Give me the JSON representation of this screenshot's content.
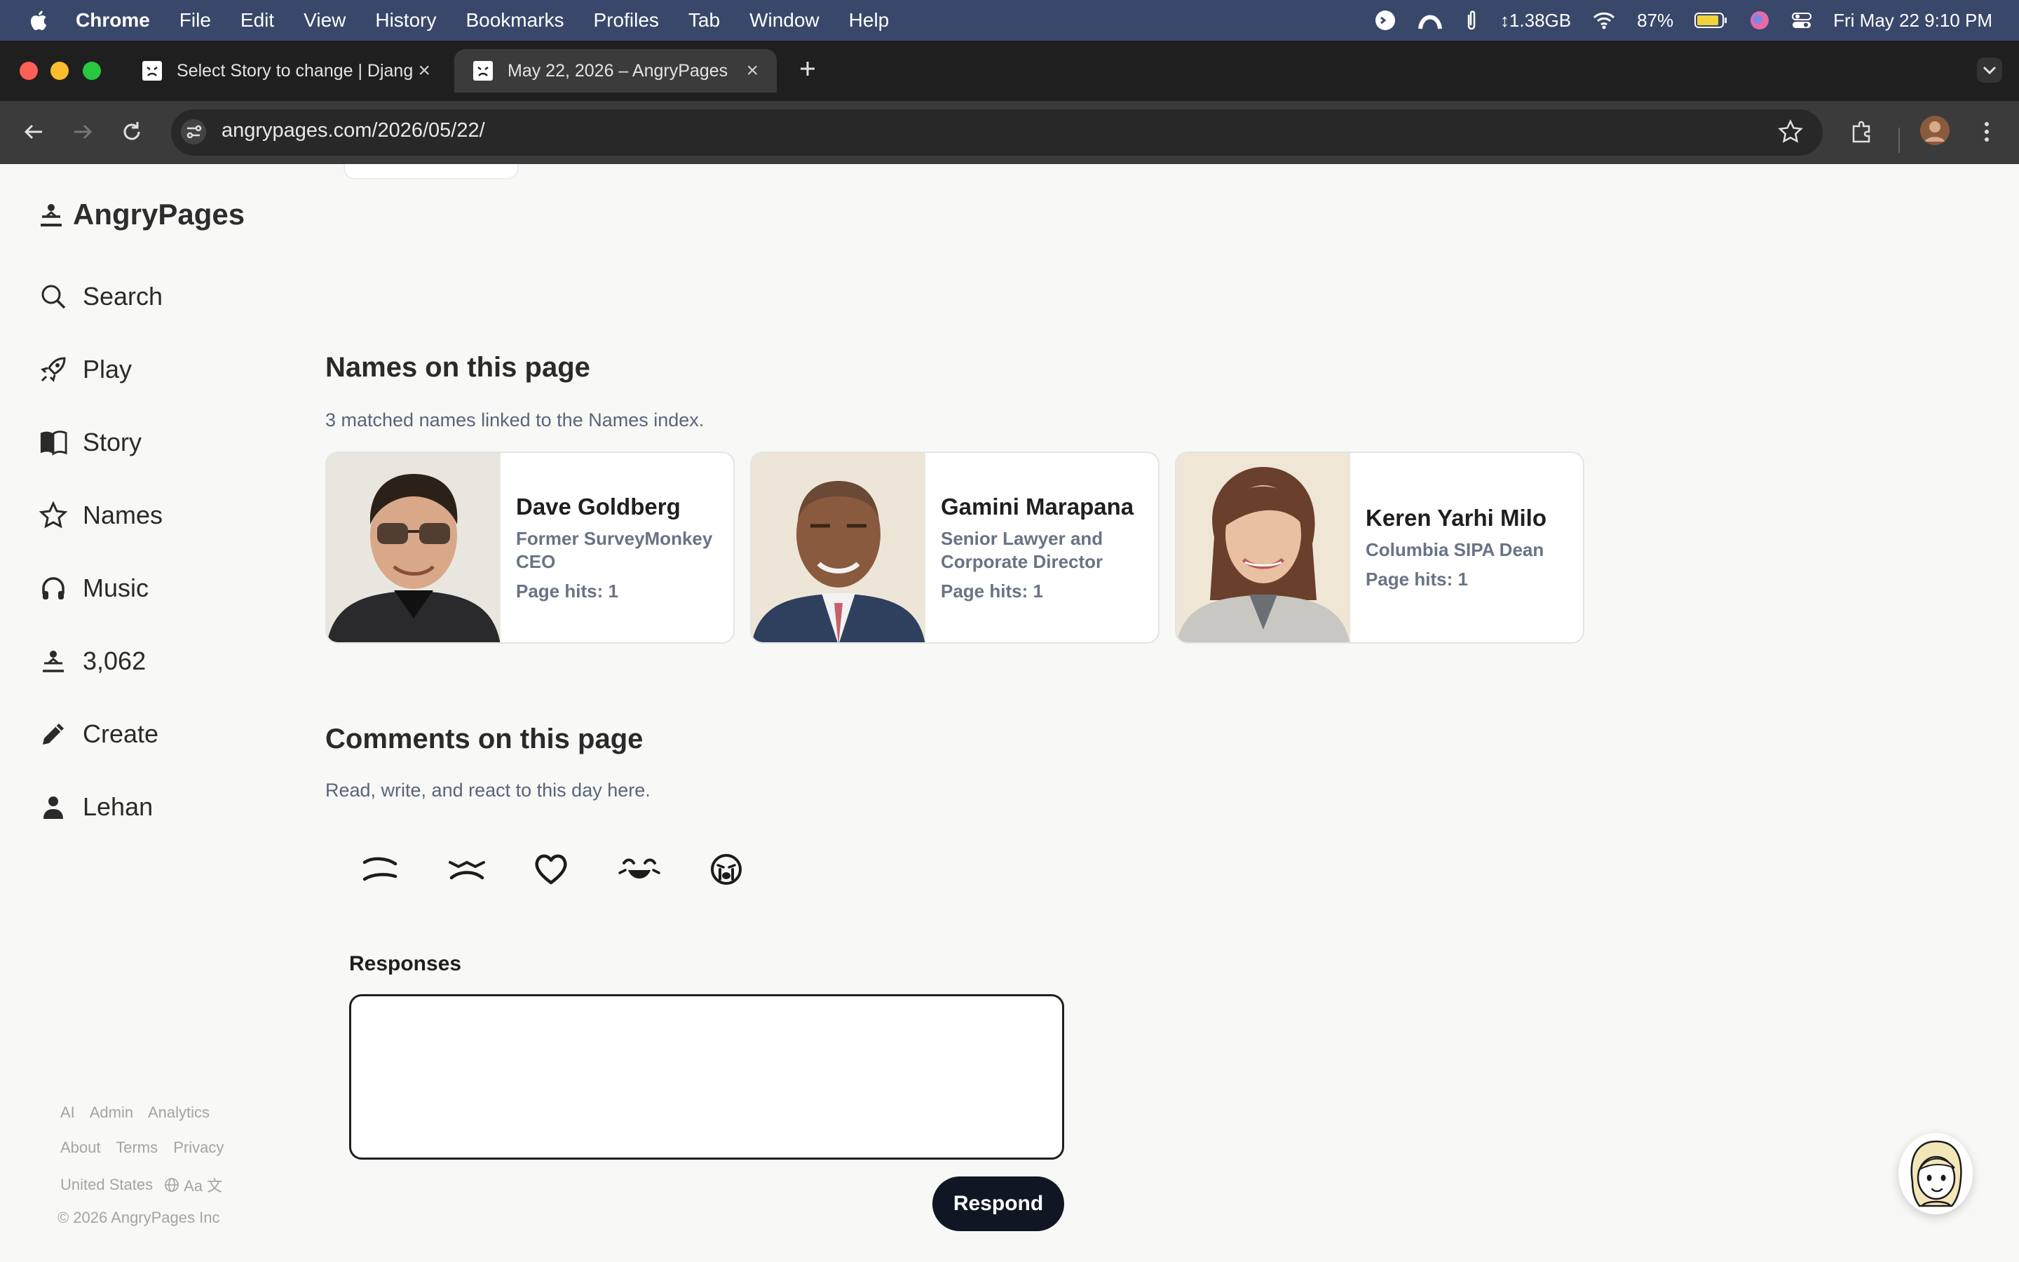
{
  "menubar": {
    "app": "Chrome",
    "items": [
      "File",
      "Edit",
      "View",
      "History",
      "Bookmarks",
      "Profiles",
      "Tab",
      "Window",
      "Help"
    ],
    "memory": "↕1.38GB",
    "battery": "87%",
    "datetime": "Fri May 22  9:10 PM"
  },
  "tabs": [
    {
      "title": "Select Story to change | Djang"
    },
    {
      "title": "May 22, 2026 – AngryPages"
    }
  ],
  "url": "angrypages.com/2026/05/22/",
  "brand": "AngryPages",
  "nav": [
    {
      "label": "Search",
      "icon": "search-icon"
    },
    {
      "label": "Play",
      "icon": "rocket-icon"
    },
    {
      "label": "Story",
      "icon": "book-icon"
    },
    {
      "label": "Names",
      "icon": "star-icon"
    },
    {
      "label": "Music",
      "icon": "headphones-icon"
    },
    {
      "label": "3,062",
      "icon": "angry-face-icon"
    },
    {
      "label": "Create",
      "icon": "pencil-icon"
    },
    {
      "label": "Lehan",
      "icon": "person-icon"
    }
  ],
  "footer": {
    "row1": [
      "AI",
      "Admin",
      "Analytics"
    ],
    "row2": [
      "About",
      "Terms",
      "Privacy"
    ],
    "region": "United States",
    "language": "Aa 文",
    "copyright": "© 2026 AngryPages Inc"
  },
  "names_section": {
    "title": "Names on this page",
    "subtitle": "3 matched names linked to the Names index.",
    "cards": [
      {
        "name": "Dave Goldberg",
        "role_line1": "Former SurveyMonkey",
        "role_line2": "CEO",
        "hits": "Page hits: 1"
      },
      {
        "name": "Gamini Marapana",
        "role_line1": "Senior Lawyer and",
        "role_line2": "Corporate Director",
        "hits": "Page hits: 1"
      },
      {
        "name": "Keren Yarhi Milo",
        "role_line1": "Columbia SIPA Dean",
        "role_line2": "",
        "hits": "Page hits: 1"
      }
    ]
  },
  "comments_section": {
    "title": "Comments on this page",
    "subtitle": "Read, write, and react to this day here.",
    "reactions": [
      "frown-reaction-icon",
      "squint-reaction-icon",
      "heart-reaction-icon",
      "laugh-reaction-icon",
      "cry-reaction-icon"
    ],
    "responses_label": "Responses",
    "response_placeholder": "",
    "respond_button": "Respond"
  }
}
